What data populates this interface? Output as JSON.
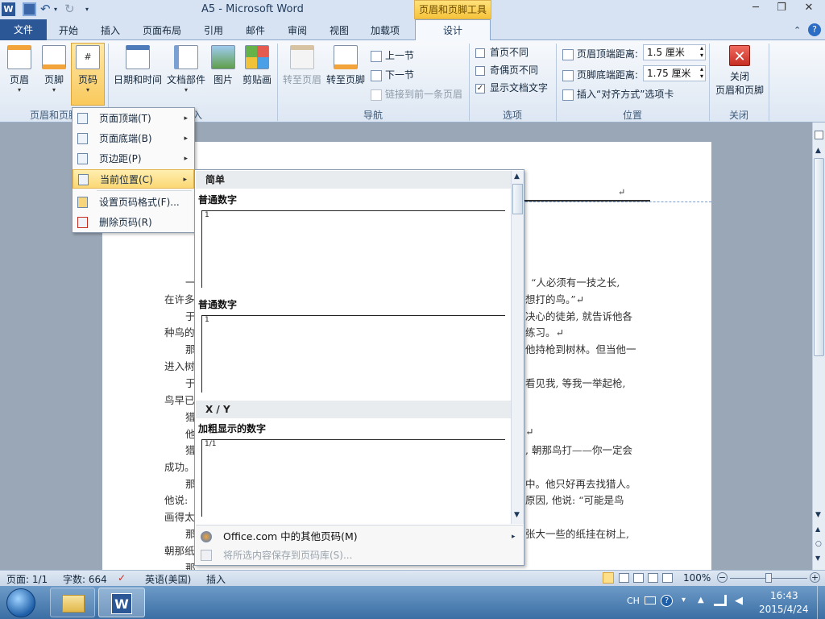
{
  "title_bar": {
    "title": "A5 - Microsoft Word",
    "context_tab_group": "页眉和页脚工具"
  },
  "tabs": {
    "file": "文件",
    "home": "开始",
    "insert": "插入",
    "layout": "页面布局",
    "references": "引用",
    "mailings": "邮件",
    "review": "审阅",
    "view": "视图",
    "addins": "加载项",
    "design": "设计"
  },
  "ribbon": {
    "header_footer": {
      "header": "页眉",
      "footer": "页脚",
      "page_number": "页码",
      "group_label": "页眉和页脚"
    },
    "insert": {
      "datetime": "日期和时间",
      "docparts": "文档部件",
      "picture": "图片",
      "clipart": "剪贴画",
      "group_label": "插入"
    },
    "navigation": {
      "goto_header": "转至页眉",
      "goto_footer": "转至页脚",
      "prev": "上一节",
      "next": "下一节",
      "link_prev": "链接到前一条页眉",
      "group_label": "导航"
    },
    "options": {
      "diff_first": "首页不同",
      "diff_odd_even": "奇偶页不同",
      "show_text": "显示文档文字",
      "diff_first_checked": false,
      "diff_odd_even_checked": false,
      "show_text_checked": true,
      "group_label": "选项"
    },
    "position": {
      "header_dist_label": "页眉顶端距离:",
      "header_dist_value": "1.5 厘米",
      "footer_dist_label": "页脚底端距离:",
      "footer_dist_value": "1.75 厘米",
      "insert_align_tab": "插入“对齐方式”选项卡",
      "group_label": "位置"
    },
    "close": {
      "label": "关闭\n页眉和页脚",
      "line1": "关闭",
      "line2": "页眉和页脚",
      "group_label": "关闭"
    }
  },
  "page_number_menu": {
    "items": [
      {
        "label": "页面顶端(T)",
        "has_submenu": true
      },
      {
        "label": "页面底端(B)",
        "has_submenu": true
      },
      {
        "label": "页边距(P)",
        "has_submenu": true
      },
      {
        "label": "当前位置(C)",
        "has_submenu": true,
        "highlighted": true
      },
      {
        "label": "设置页码格式(F)...",
        "has_submenu": false
      },
      {
        "label": "删除页码(R)",
        "has_submenu": false
      }
    ]
  },
  "current_position_submenu": {
    "section_simple": "简单",
    "item1_label": "普通数字",
    "item1_preview": "1",
    "item2_label": "普通数字",
    "item2_preview": "1",
    "section_xy": "X / Y",
    "item3_label": "加粗显示的数字",
    "item3_preview": "1/1",
    "footer_more": "Office.com 中的其他页码(M)",
    "footer_save": "将所选内容保存到页码库(S)..."
  },
  "document": {
    "lines_right": [
      "说：“人必须有一技之长,",
      "想打的鸟。”↵",
      "决心的徒弟, 就告诉他各",
      "练习。↵",
      "他持枪到树林。但当他一",
      "看见我, 等我一举起枪,",
      "↵",
      ", 朝那鸟打——你一定会",
      "中。他只好再去找猎人。",
      "原因, 他说: “可能是鸟",
      "张大一些的纸挂在树上,"
    ],
    "lines_left": [
      "在许多",
      "种鸟的",
      "进入树",
      "鸟早已",
      "成功。",
      "他说:",
      "画得太",
      "朝那纸"
    ],
    "indent_chars": [
      "一",
      "于",
      "那",
      "于",
      "猎",
      "他",
      "猎",
      "那",
      "那",
      "那"
    ]
  },
  "status_bar": {
    "page": "页面: 1/1",
    "words": "字数: 664",
    "language": "英语(美国)",
    "mode": "插入",
    "zoom": "100%"
  },
  "taskbar": {
    "time": "16:43",
    "date": "2015/4/24",
    "ime": "CH"
  }
}
